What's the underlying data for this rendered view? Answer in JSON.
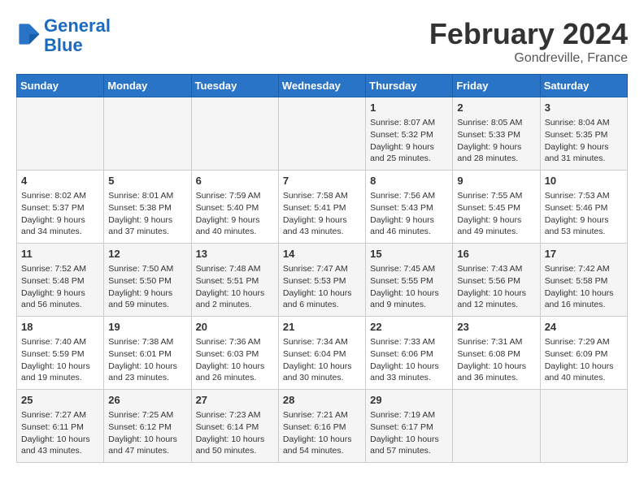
{
  "header": {
    "logo_line1": "General",
    "logo_line2": "Blue",
    "month": "February 2024",
    "location": "Gondreville, France"
  },
  "days_of_week": [
    "Sunday",
    "Monday",
    "Tuesday",
    "Wednesday",
    "Thursday",
    "Friday",
    "Saturday"
  ],
  "weeks": [
    [
      {
        "day": "",
        "info": ""
      },
      {
        "day": "",
        "info": ""
      },
      {
        "day": "",
        "info": ""
      },
      {
        "day": "",
        "info": ""
      },
      {
        "day": "1",
        "info": "Sunrise: 8:07 AM\nSunset: 5:32 PM\nDaylight: 9 hours\nand 25 minutes."
      },
      {
        "day": "2",
        "info": "Sunrise: 8:05 AM\nSunset: 5:33 PM\nDaylight: 9 hours\nand 28 minutes."
      },
      {
        "day": "3",
        "info": "Sunrise: 8:04 AM\nSunset: 5:35 PM\nDaylight: 9 hours\nand 31 minutes."
      }
    ],
    [
      {
        "day": "4",
        "info": "Sunrise: 8:02 AM\nSunset: 5:37 PM\nDaylight: 9 hours\nand 34 minutes."
      },
      {
        "day": "5",
        "info": "Sunrise: 8:01 AM\nSunset: 5:38 PM\nDaylight: 9 hours\nand 37 minutes."
      },
      {
        "day": "6",
        "info": "Sunrise: 7:59 AM\nSunset: 5:40 PM\nDaylight: 9 hours\nand 40 minutes."
      },
      {
        "day": "7",
        "info": "Sunrise: 7:58 AM\nSunset: 5:41 PM\nDaylight: 9 hours\nand 43 minutes."
      },
      {
        "day": "8",
        "info": "Sunrise: 7:56 AM\nSunset: 5:43 PM\nDaylight: 9 hours\nand 46 minutes."
      },
      {
        "day": "9",
        "info": "Sunrise: 7:55 AM\nSunset: 5:45 PM\nDaylight: 9 hours\nand 49 minutes."
      },
      {
        "day": "10",
        "info": "Sunrise: 7:53 AM\nSunset: 5:46 PM\nDaylight: 9 hours\nand 53 minutes."
      }
    ],
    [
      {
        "day": "11",
        "info": "Sunrise: 7:52 AM\nSunset: 5:48 PM\nDaylight: 9 hours\nand 56 minutes."
      },
      {
        "day": "12",
        "info": "Sunrise: 7:50 AM\nSunset: 5:50 PM\nDaylight: 9 hours\nand 59 minutes."
      },
      {
        "day": "13",
        "info": "Sunrise: 7:48 AM\nSunset: 5:51 PM\nDaylight: 10 hours\nand 2 minutes."
      },
      {
        "day": "14",
        "info": "Sunrise: 7:47 AM\nSunset: 5:53 PM\nDaylight: 10 hours\nand 6 minutes."
      },
      {
        "day": "15",
        "info": "Sunrise: 7:45 AM\nSunset: 5:55 PM\nDaylight: 10 hours\nand 9 minutes."
      },
      {
        "day": "16",
        "info": "Sunrise: 7:43 AM\nSunset: 5:56 PM\nDaylight: 10 hours\nand 12 minutes."
      },
      {
        "day": "17",
        "info": "Sunrise: 7:42 AM\nSunset: 5:58 PM\nDaylight: 10 hours\nand 16 minutes."
      }
    ],
    [
      {
        "day": "18",
        "info": "Sunrise: 7:40 AM\nSunset: 5:59 PM\nDaylight: 10 hours\nand 19 minutes."
      },
      {
        "day": "19",
        "info": "Sunrise: 7:38 AM\nSunset: 6:01 PM\nDaylight: 10 hours\nand 23 minutes."
      },
      {
        "day": "20",
        "info": "Sunrise: 7:36 AM\nSunset: 6:03 PM\nDaylight: 10 hours\nand 26 minutes."
      },
      {
        "day": "21",
        "info": "Sunrise: 7:34 AM\nSunset: 6:04 PM\nDaylight: 10 hours\nand 30 minutes."
      },
      {
        "day": "22",
        "info": "Sunrise: 7:33 AM\nSunset: 6:06 PM\nDaylight: 10 hours\nand 33 minutes."
      },
      {
        "day": "23",
        "info": "Sunrise: 7:31 AM\nSunset: 6:08 PM\nDaylight: 10 hours\nand 36 minutes."
      },
      {
        "day": "24",
        "info": "Sunrise: 7:29 AM\nSunset: 6:09 PM\nDaylight: 10 hours\nand 40 minutes."
      }
    ],
    [
      {
        "day": "25",
        "info": "Sunrise: 7:27 AM\nSunset: 6:11 PM\nDaylight: 10 hours\nand 43 minutes."
      },
      {
        "day": "26",
        "info": "Sunrise: 7:25 AM\nSunset: 6:12 PM\nDaylight: 10 hours\nand 47 minutes."
      },
      {
        "day": "27",
        "info": "Sunrise: 7:23 AM\nSunset: 6:14 PM\nDaylight: 10 hours\nand 50 minutes."
      },
      {
        "day": "28",
        "info": "Sunrise: 7:21 AM\nSunset: 6:16 PM\nDaylight: 10 hours\nand 54 minutes."
      },
      {
        "day": "29",
        "info": "Sunrise: 7:19 AM\nSunset: 6:17 PM\nDaylight: 10 hours\nand 57 minutes."
      },
      {
        "day": "",
        "info": ""
      },
      {
        "day": "",
        "info": ""
      }
    ]
  ]
}
